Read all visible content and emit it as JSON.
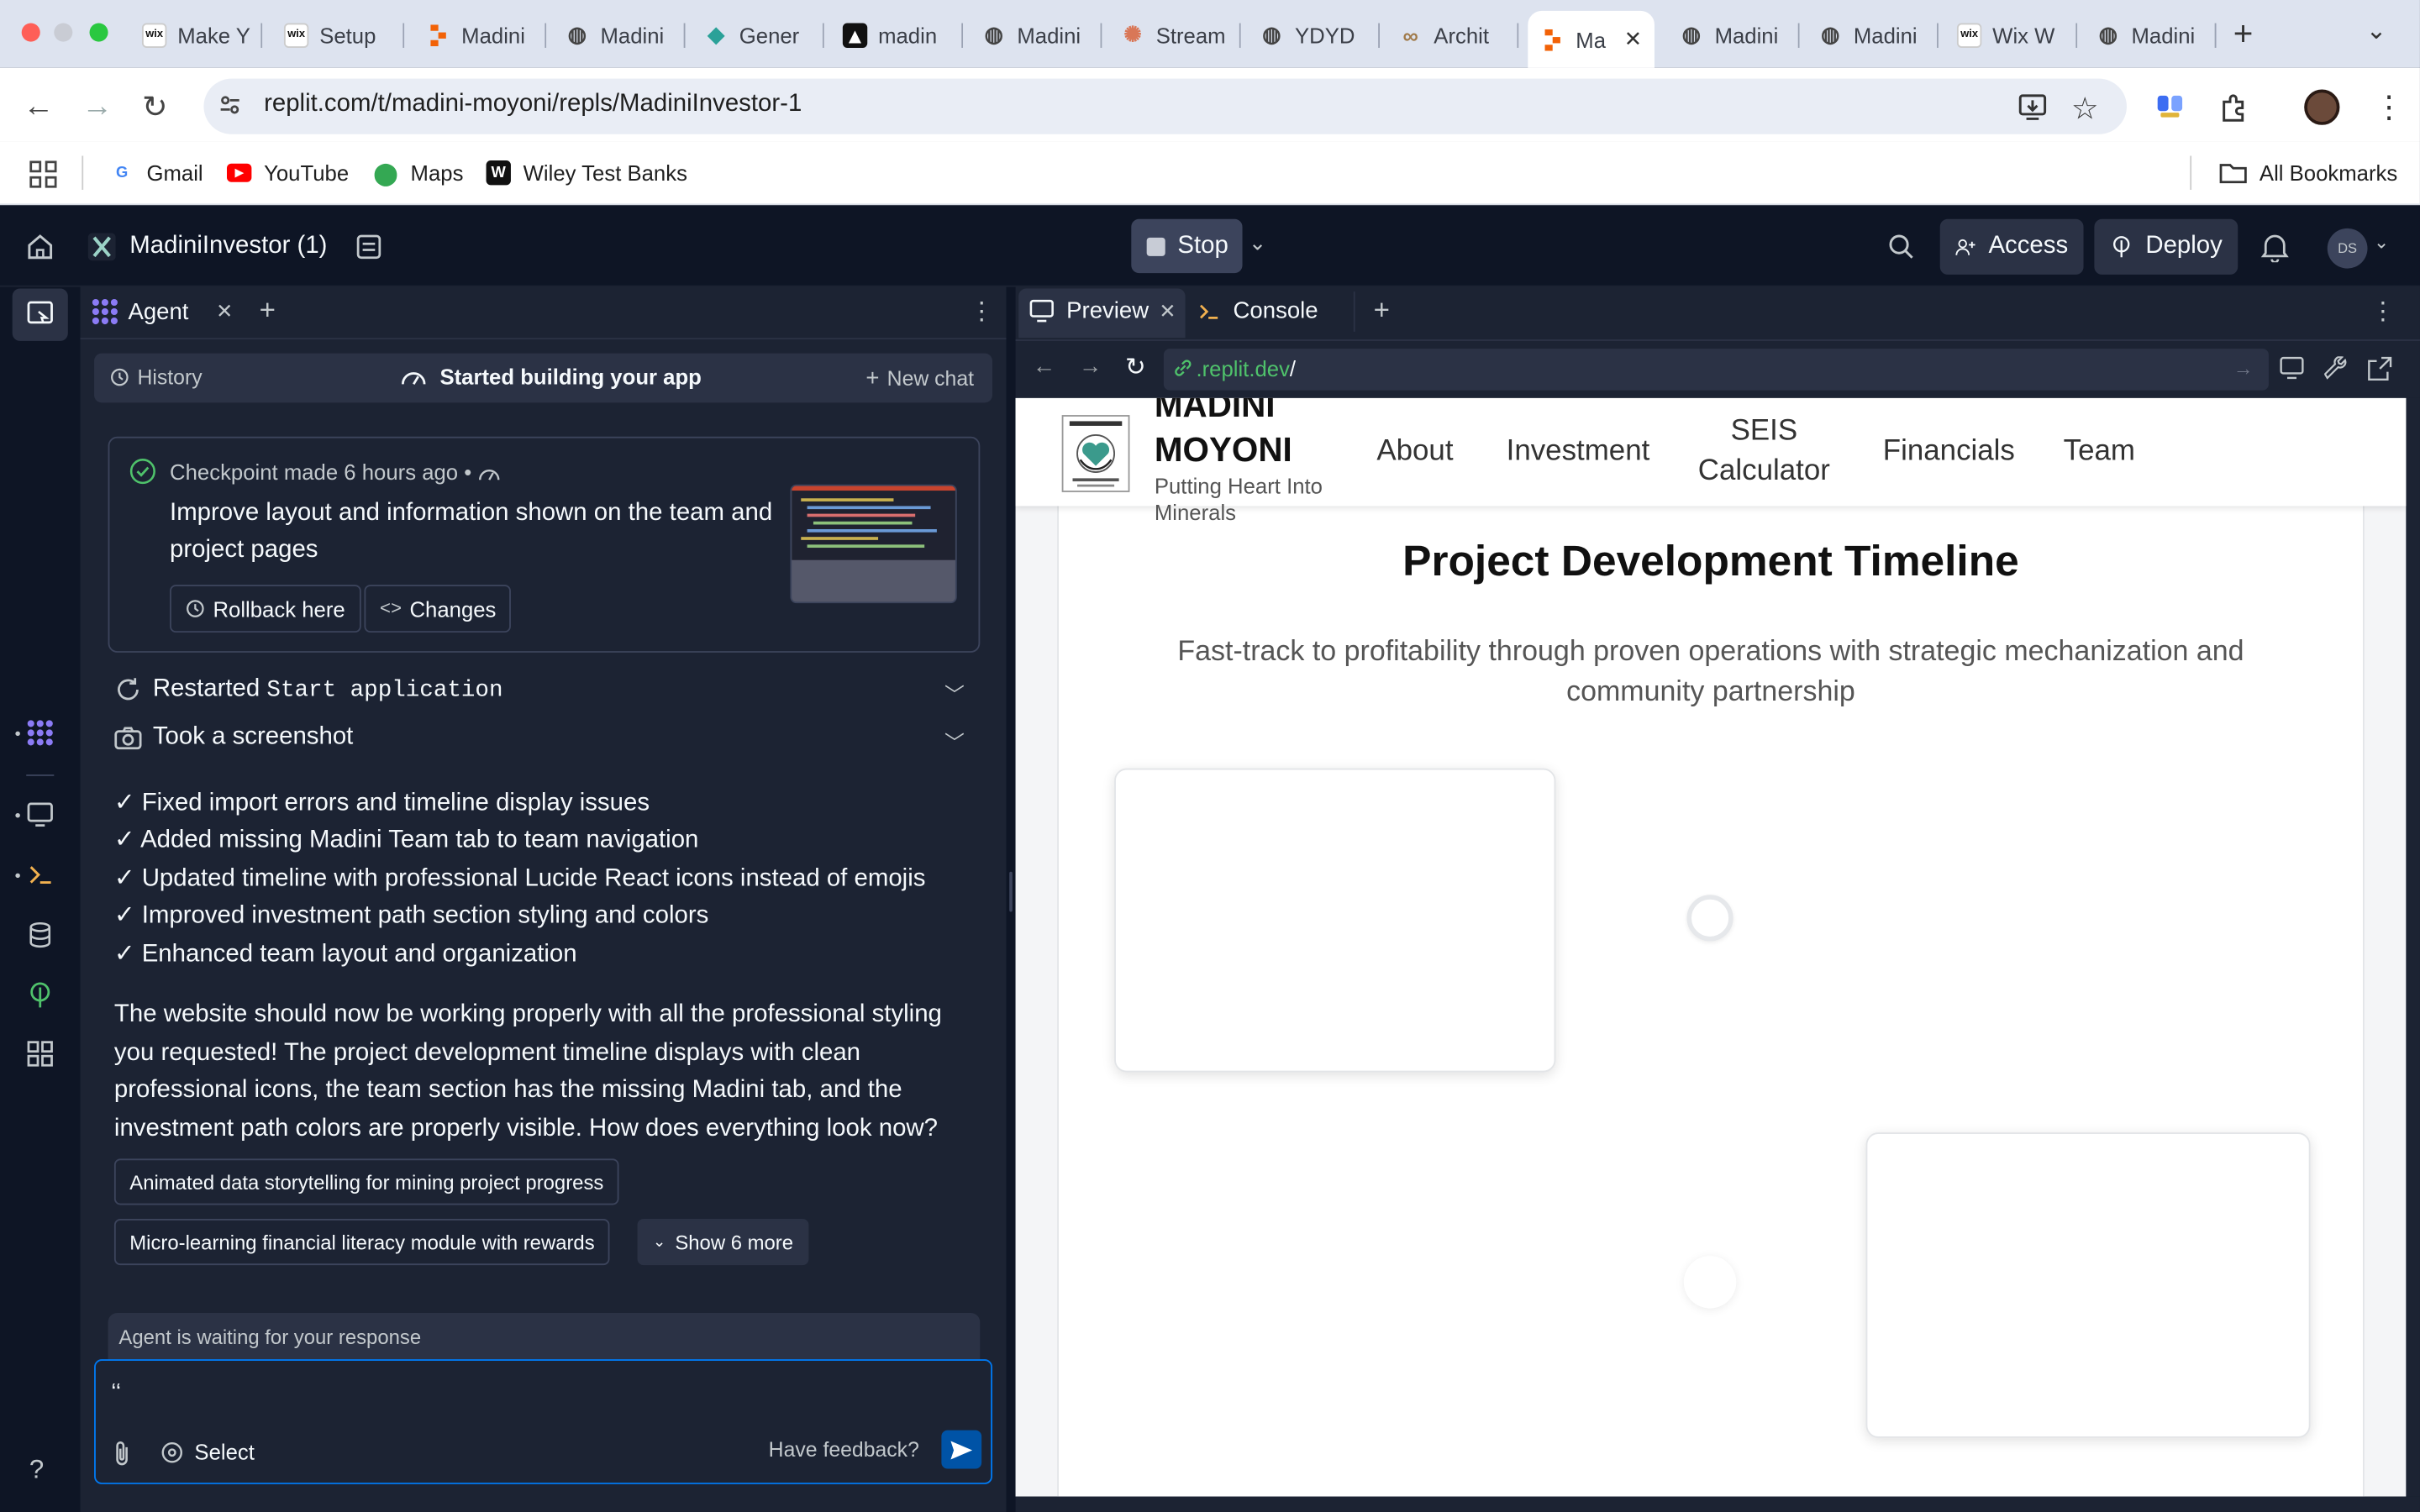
{
  "browser": {
    "tabs": [
      {
        "label": "Make Y",
        "favicon": "wix-icon"
      },
      {
        "label": "Setup",
        "favicon": "wix-icon"
      },
      {
        "label": "Madini",
        "favicon": "replit-icon"
      },
      {
        "label": "Madini",
        "favicon": "globe-icon"
      },
      {
        "label": "Gener",
        "favicon": "diamond-icon"
      },
      {
        "label": "madin",
        "favicon": "triangle-icon"
      },
      {
        "label": "Madini",
        "favicon": "globe-icon"
      },
      {
        "label": "Stream",
        "favicon": "sparkle-icon"
      },
      {
        "label": "YDYD",
        "favicon": "globe-icon"
      },
      {
        "label": "Archit",
        "favicon": "loop-icon"
      },
      {
        "label": "Ma",
        "favicon": "replit-icon",
        "active": true
      },
      {
        "label": "Madini",
        "favicon": "globe-icon"
      },
      {
        "label": "Madini",
        "favicon": "globe-icon"
      },
      {
        "label": "Wix W",
        "favicon": "wix-icon"
      },
      {
        "label": "Madini",
        "favicon": "globe-icon"
      }
    ],
    "close_glyph": "✕",
    "new_tab_glyph": "+",
    "url": "replit.com/t/madini-moyoni/repls/MadiniInvestor-1",
    "bookmarks": [
      {
        "label": "Gmail"
      },
      {
        "label": "YouTube"
      },
      {
        "label": "Maps"
      },
      {
        "label": "Wiley Test Banks"
      }
    ],
    "all_bookmarks": "All Bookmarks"
  },
  "replit": {
    "project_name": "MadiniInvestor (1)",
    "stop_label": "Stop",
    "access_label": "Access",
    "deploy_label": "Deploy",
    "avatar_initials": "DS"
  },
  "agent": {
    "tab_label": "Agent",
    "history_label": "History",
    "status_label": "Started building your app",
    "new_chat_label": "New chat",
    "checkpoint": {
      "title": "Checkpoint made",
      "time": "6 hours ago",
      "dot": "•",
      "description": "Improve layout and information shown on the team and project pages",
      "rollback_label": "Rollback here",
      "changes_label": "Changes"
    },
    "restarted_prefix": "Restarted",
    "restarted_code": "Start application",
    "screenshot_label": "Took a screenshot",
    "bullets": [
      "✓ Fixed import errors and timeline display issues",
      "✓ Added missing Madini Team tab to team navigation",
      "✓ Updated timeline with professional Lucide React icons instead of emojis",
      "✓ Improved investment path section styling and colors",
      "✓ Enhanced team layout and organization"
    ],
    "message": "The website should now be working properly with all the professional styling you requested! The project development timeline displays with clean professional icons, the team section has the missing Madini tab, and the investment path colors are properly visible. How does everything look now?",
    "suggestions": [
      "Animated data storytelling for mining project progress",
      "Micro-learning financial literacy module with rewards"
    ],
    "show_more_label": "Show 6 more",
    "waiting_label": "Agent is waiting for your response",
    "input_value": "‘‘",
    "select_label": "Select",
    "feedback_label": "Have feedback?",
    "help_glyph": "?"
  },
  "preview": {
    "tab_preview": "Preview",
    "tab_console": "Console",
    "url_domain": ".replit.dev",
    "url_path": "/",
    "site": {
      "brand_line1": "MADINI",
      "brand_line2": "MOYONI",
      "tagline": "Putting Heart Into Minerals",
      "nav": [
        "About",
        "Investment",
        "SEIS Calculator",
        "Financials",
        "Team"
      ],
      "heading": "Project Development Timeline",
      "subheading": "Fast-track to profitability through proven operations with strategic mechanization and community partnership"
    }
  },
  "colors": {
    "replit_bg": "#0e1525",
    "panel_bg": "#1c2333",
    "accent_blue": "#0079f2",
    "checkpoint_green": "#4fc26b"
  }
}
